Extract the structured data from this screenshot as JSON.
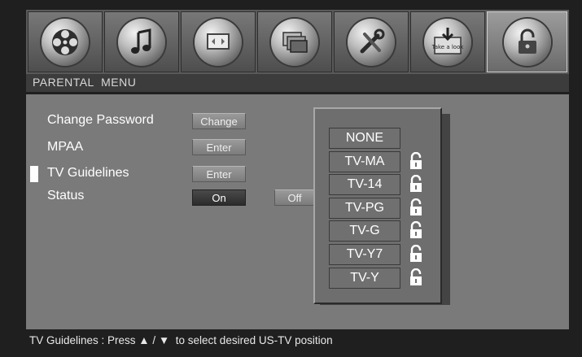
{
  "menu_tabs": [
    {
      "name": "movie-reel-icon",
      "active": false
    },
    {
      "name": "music-note-icon",
      "active": false
    },
    {
      "name": "display-screen-icon",
      "active": false
    },
    {
      "name": "pictures-icon",
      "active": false
    },
    {
      "name": "tools-icon",
      "active": false
    },
    {
      "name": "take-a-look-icon",
      "active": false,
      "caption": "Take a look"
    },
    {
      "name": "padlock-icon",
      "active": true
    }
  ],
  "header": {
    "title": "PARENTAL  MENU"
  },
  "settings": {
    "change_password": {
      "label": "Change Password",
      "button": "Change"
    },
    "mpaa": {
      "label": "MPAA",
      "button": "Enter"
    },
    "tv_guidelines": {
      "label": "TV Guidelines",
      "button": "Enter"
    },
    "status": {
      "label": "Status",
      "on": "On",
      "off": "Off",
      "selected": "On"
    }
  },
  "ratings": [
    {
      "label": "NONE",
      "locked": false
    },
    {
      "label": "TV-MA",
      "locked": true
    },
    {
      "label": "TV-14",
      "locked": true
    },
    {
      "label": "TV-PG",
      "locked": true
    },
    {
      "label": "TV-G",
      "locked": true
    },
    {
      "label": "TV-Y7",
      "locked": true
    },
    {
      "label": "TV-Y",
      "locked": true
    }
  ],
  "footer": {
    "hint": "TV Guidelines : Press ▲ / ▼  to select desired US-TV position"
  },
  "colors": {
    "panel": "#7a7a7a",
    "highlight": "#ffffff",
    "selected_button": "#333333"
  }
}
